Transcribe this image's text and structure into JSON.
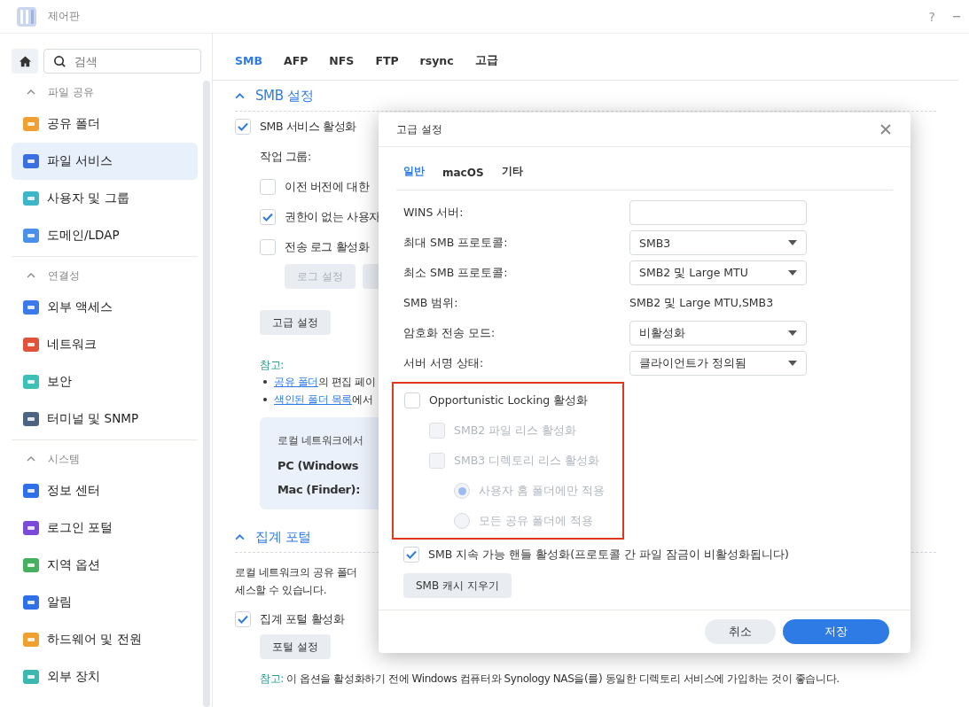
{
  "window": {
    "title": "제어판",
    "help": "?"
  },
  "sidebar": {
    "search": {
      "placeholder": "검색"
    },
    "groups": [
      {
        "title": "파일 공유",
        "expanded": true,
        "items": [
          {
            "label": "공유 폴더",
            "selected": false
          },
          {
            "label": "파일 서비스",
            "selected": true
          },
          {
            "label": "사용자 및 그룹",
            "selected": false
          },
          {
            "label": "도메인/LDAP",
            "selected": false
          }
        ]
      },
      {
        "title": "연결성",
        "expanded": true,
        "items": [
          {
            "label": "외부 액세스",
            "selected": false
          },
          {
            "label": "네트워크",
            "selected": false
          },
          {
            "label": "보안",
            "selected": false
          },
          {
            "label": "터미널 및 SNMP",
            "selected": false
          }
        ]
      },
      {
        "title": "시스템",
        "expanded": true,
        "items": [
          {
            "label": "정보 센터",
            "selected": false
          },
          {
            "label": "로그인 포털",
            "selected": false
          },
          {
            "label": "지역 옵션",
            "selected": false
          },
          {
            "label": "알림",
            "selected": false
          },
          {
            "label": "하드웨어 및 전원",
            "selected": false
          },
          {
            "label": "외부 장치",
            "selected": false
          }
        ]
      }
    ]
  },
  "tabs": [
    {
      "label": "SMB",
      "selected": true
    },
    {
      "label": "AFP",
      "selected": false
    },
    {
      "label": "NFS",
      "selected": false
    },
    {
      "label": "FTP",
      "selected": false
    },
    {
      "label": "rsync",
      "selected": false
    },
    {
      "label": "고급",
      "selected": false
    }
  ],
  "smb_section": {
    "title": "SMB 설정",
    "expanded": true,
    "enable": {
      "label": "SMB 서비스 활성화",
      "checked": true
    },
    "workgroup_label": "작업 그룹:",
    "options": [
      {
        "label": "이전 버전에 대한",
        "checked": false
      },
      {
        "label": "권한이 없는 사용자",
        "checked": true
      },
      {
        "label": "전송 로그 활성화",
        "checked": false
      }
    ],
    "log_buttons": [
      {
        "label": "로그 설정",
        "disabled": true
      },
      {
        "disabled": true
      }
    ],
    "advanced_button": "고급 설정",
    "note": {
      "label": "참고:",
      "bullets": [
        {
          "link": "공유 폴더",
          "text": "의 편집 페이"
        },
        {
          "link": "색인된 폴더 목록",
          "text": "에서"
        }
      ]
    },
    "info_box": {
      "intro": "로컬 네트워크에서",
      "pc": "PC (Windows",
      "mac": "Mac (Finder):"
    }
  },
  "portal_section": {
    "title": "집계 포털",
    "expanded": true,
    "description": [
      "로컬 네트워크의 공유 폴더",
      "세스할 수 있습니다."
    ],
    "enable": {
      "label": "집계 포털 활성화",
      "checked": true
    },
    "button": "포털 설정",
    "note": {
      "label": "참고:",
      "text": "이 옵션을 활성화하기 전에 Windows 컴퓨터와 Synology NAS을(를) 동일한 디렉토리 서비스에 가입하는 것이 좋습니다."
    }
  },
  "dialog": {
    "title": "고급 설정",
    "tabs": [
      {
        "label": "일반",
        "selected": true
      },
      {
        "label": "macOS",
        "selected": false
      },
      {
        "label": "기타",
        "selected": false
      }
    ],
    "fields": [
      {
        "kind": "input",
        "label": "WINS 서버:"
      },
      {
        "kind": "select",
        "label": "최대 SMB 프로토콜:",
        "value": "SMB3"
      },
      {
        "kind": "select",
        "label": "최소 SMB 프로토콜:",
        "value": "SMB2 및 Large MTU"
      },
      {
        "kind": "text",
        "label": "SMB 범위:",
        "value": "SMB2 및 Large MTU,SMB3"
      },
      {
        "kind": "select",
        "label": "암호화 전송 모드:",
        "value": "비활성화"
      },
      {
        "kind": "select",
        "label": "서버 서명 상태:",
        "value": "클라이언트가 정의됨"
      }
    ],
    "oplock": {
      "highlighted": true,
      "kind": "checkbox",
      "label": "Opportunistic Locking 활성화",
      "checked": false,
      "disabled": false,
      "children": [
        {
          "kind": "checkbox",
          "label": "SMB2 파일 리스 활성화",
          "checked": false,
          "disabled": true
        },
        {
          "kind": "checkbox",
          "label": "SMB3 디렉토리 리스 활성화",
          "checked": false,
          "disabled": true,
          "children": [
            {
              "kind": "radio",
              "label": "사용자 홈 폴더에만 적용",
              "selected": true,
              "disabled": true
            },
            {
              "kind": "radio",
              "label": "모든 공유 폴더에 적용",
              "selected": false,
              "disabled": true
            }
          ]
        }
      ]
    },
    "durable": {
      "label": "SMB 지속 가능 핸들 활성화(프로토콜 간 파일 잠금이 비활성화됩니다)",
      "checked": true
    },
    "clear_cache_button": "SMB 캐시 지우기",
    "buttons": [
      {
        "kind": "secondary",
        "label": "취소"
      },
      {
        "kind": "primary",
        "label": "저장"
      }
    ]
  }
}
